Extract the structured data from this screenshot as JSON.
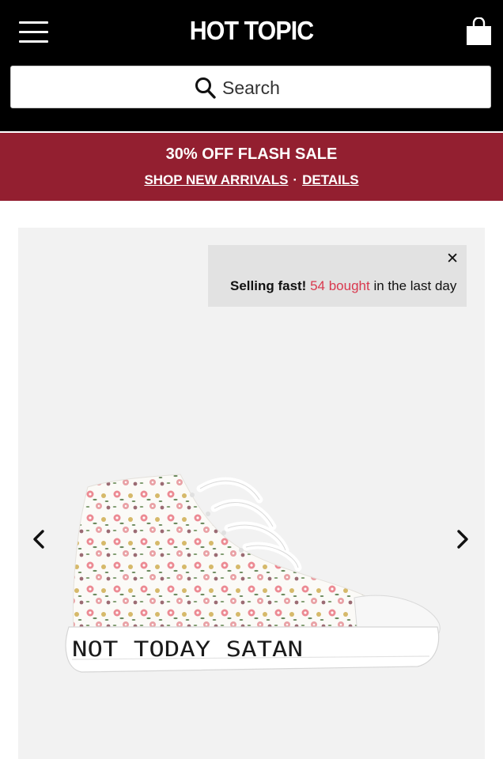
{
  "header": {
    "logo_text": "HOT TOPIC",
    "menu_icon": "hamburger-menu-icon",
    "bag_icon": "shopping-bag-icon",
    "background": "#000000"
  },
  "search": {
    "placeholder": "Search",
    "icon": "search-icon"
  },
  "promo": {
    "headline": "30% OFF FLASH SALE",
    "link_new_arrivals": "SHOP NEW ARRIVALS",
    "separator": "·",
    "link_details": "DETAILS",
    "background": "#931f30"
  },
  "gallery": {
    "toast": {
      "prefix": "Selling fast!",
      "count": "54 bought",
      "suffix": "in the last day",
      "close_icon": "close-icon",
      "accent": "#d9384e"
    },
    "prev_icon": "chevron-left-icon",
    "next_icon": "chevron-right-icon",
    "product_text": "NOT TODAY SATAN"
  }
}
